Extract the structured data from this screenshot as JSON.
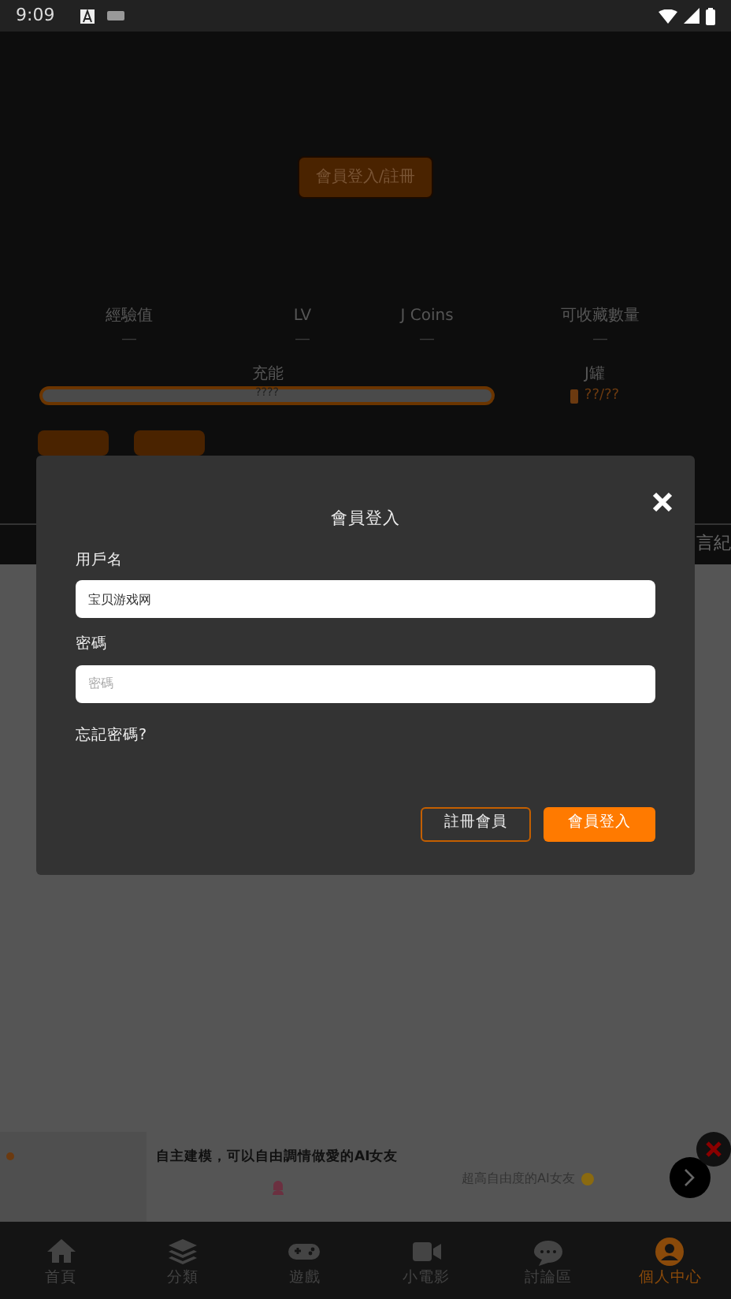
{
  "status_bar": {
    "time": "9:09"
  },
  "profile": {
    "login_button": "會員登入/註冊",
    "stats": [
      {
        "label": "經驗值",
        "value": "—"
      },
      {
        "label": "LV",
        "value": "—"
      },
      {
        "label": "J Coins",
        "value": "—"
      },
      {
        "label": "可收藏數量",
        "value": "—"
      }
    ],
    "energy": {
      "label": "充能",
      "reading": "????"
    },
    "jar": {
      "label": "J罐",
      "reading": "??/??"
    },
    "tab_fragment": "言紀"
  },
  "login_dialog": {
    "title": "會員登入",
    "fields": [
      {
        "label": "用戶名",
        "value": "宝贝游戏网"
      },
      {
        "label": "密碼",
        "placeholder": "密碼"
      }
    ],
    "forgot": "忘記密碼?",
    "buttons": [
      {
        "label": "註冊會員",
        "kind": "outline"
      },
      {
        "label": "會員登入",
        "kind": "primary"
      }
    ]
  },
  "ad": {
    "headline": "自主建模，可以自由調情做愛的AI女友",
    "tagline": "超高自由度的AI女友"
  },
  "bottom_nav": [
    {
      "label": "首頁",
      "selected": false
    },
    {
      "label": "分類",
      "selected": false
    },
    {
      "label": "遊戲",
      "selected": false
    },
    {
      "label": "小電影",
      "selected": false
    },
    {
      "label": "討論區",
      "selected": false
    },
    {
      "label": "個人中心",
      "selected": true
    }
  ]
}
